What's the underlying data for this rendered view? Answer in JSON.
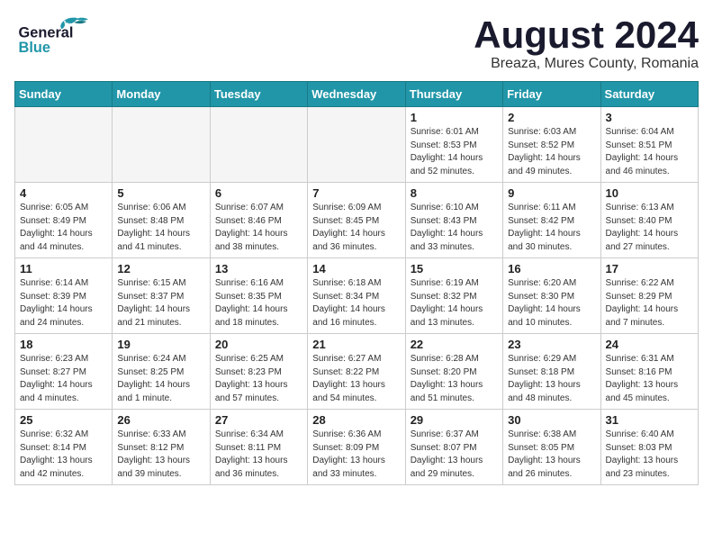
{
  "header": {
    "logo_general": "General",
    "logo_blue": "Blue",
    "month_title": "August 2024",
    "location": "Breaza, Mures County, Romania"
  },
  "weekdays": [
    "Sunday",
    "Monday",
    "Tuesday",
    "Wednesday",
    "Thursday",
    "Friday",
    "Saturday"
  ],
  "weeks": [
    [
      {
        "day": "",
        "empty": true
      },
      {
        "day": "",
        "empty": true
      },
      {
        "day": "",
        "empty": true
      },
      {
        "day": "",
        "empty": true
      },
      {
        "day": "1",
        "sunrise": "6:01 AM",
        "sunset": "8:53 PM",
        "daylight": "14 hours and 52 minutes."
      },
      {
        "day": "2",
        "sunrise": "6:03 AM",
        "sunset": "8:52 PM",
        "daylight": "14 hours and 49 minutes."
      },
      {
        "day": "3",
        "sunrise": "6:04 AM",
        "sunset": "8:51 PM",
        "daylight": "14 hours and 46 minutes."
      }
    ],
    [
      {
        "day": "4",
        "sunrise": "6:05 AM",
        "sunset": "8:49 PM",
        "daylight": "14 hours and 44 minutes."
      },
      {
        "day": "5",
        "sunrise": "6:06 AM",
        "sunset": "8:48 PM",
        "daylight": "14 hours and 41 minutes."
      },
      {
        "day": "6",
        "sunrise": "6:07 AM",
        "sunset": "8:46 PM",
        "daylight": "14 hours and 38 minutes."
      },
      {
        "day": "7",
        "sunrise": "6:09 AM",
        "sunset": "8:45 PM",
        "daylight": "14 hours and 36 minutes."
      },
      {
        "day": "8",
        "sunrise": "6:10 AM",
        "sunset": "8:43 PM",
        "daylight": "14 hours and 33 minutes."
      },
      {
        "day": "9",
        "sunrise": "6:11 AM",
        "sunset": "8:42 PM",
        "daylight": "14 hours and 30 minutes."
      },
      {
        "day": "10",
        "sunrise": "6:13 AM",
        "sunset": "8:40 PM",
        "daylight": "14 hours and 27 minutes."
      }
    ],
    [
      {
        "day": "11",
        "sunrise": "6:14 AM",
        "sunset": "8:39 PM",
        "daylight": "14 hours and 24 minutes."
      },
      {
        "day": "12",
        "sunrise": "6:15 AM",
        "sunset": "8:37 PM",
        "daylight": "14 hours and 21 minutes."
      },
      {
        "day": "13",
        "sunrise": "6:16 AM",
        "sunset": "8:35 PM",
        "daylight": "14 hours and 18 minutes."
      },
      {
        "day": "14",
        "sunrise": "6:18 AM",
        "sunset": "8:34 PM",
        "daylight": "14 hours and 16 minutes."
      },
      {
        "day": "15",
        "sunrise": "6:19 AM",
        "sunset": "8:32 PM",
        "daylight": "14 hours and 13 minutes."
      },
      {
        "day": "16",
        "sunrise": "6:20 AM",
        "sunset": "8:30 PM",
        "daylight": "14 hours and 10 minutes."
      },
      {
        "day": "17",
        "sunrise": "6:22 AM",
        "sunset": "8:29 PM",
        "daylight": "14 hours and 7 minutes."
      }
    ],
    [
      {
        "day": "18",
        "sunrise": "6:23 AM",
        "sunset": "8:27 PM",
        "daylight": "14 hours and 4 minutes."
      },
      {
        "day": "19",
        "sunrise": "6:24 AM",
        "sunset": "8:25 PM",
        "daylight": "14 hours and 1 minute."
      },
      {
        "day": "20",
        "sunrise": "6:25 AM",
        "sunset": "8:23 PM",
        "daylight": "13 hours and 57 minutes."
      },
      {
        "day": "21",
        "sunrise": "6:27 AM",
        "sunset": "8:22 PM",
        "daylight": "13 hours and 54 minutes."
      },
      {
        "day": "22",
        "sunrise": "6:28 AM",
        "sunset": "8:20 PM",
        "daylight": "13 hours and 51 minutes."
      },
      {
        "day": "23",
        "sunrise": "6:29 AM",
        "sunset": "8:18 PM",
        "daylight": "13 hours and 48 minutes."
      },
      {
        "day": "24",
        "sunrise": "6:31 AM",
        "sunset": "8:16 PM",
        "daylight": "13 hours and 45 minutes."
      }
    ],
    [
      {
        "day": "25",
        "sunrise": "6:32 AM",
        "sunset": "8:14 PM",
        "daylight": "13 hours and 42 minutes."
      },
      {
        "day": "26",
        "sunrise": "6:33 AM",
        "sunset": "8:12 PM",
        "daylight": "13 hours and 39 minutes."
      },
      {
        "day": "27",
        "sunrise": "6:34 AM",
        "sunset": "8:11 PM",
        "daylight": "13 hours and 36 minutes."
      },
      {
        "day": "28",
        "sunrise": "6:36 AM",
        "sunset": "8:09 PM",
        "daylight": "13 hours and 33 minutes."
      },
      {
        "day": "29",
        "sunrise": "6:37 AM",
        "sunset": "8:07 PM",
        "daylight": "13 hours and 29 minutes."
      },
      {
        "day": "30",
        "sunrise": "6:38 AM",
        "sunset": "8:05 PM",
        "daylight": "13 hours and 26 minutes."
      },
      {
        "day": "31",
        "sunrise": "6:40 AM",
        "sunset": "8:03 PM",
        "daylight": "13 hours and 23 minutes."
      }
    ]
  ]
}
